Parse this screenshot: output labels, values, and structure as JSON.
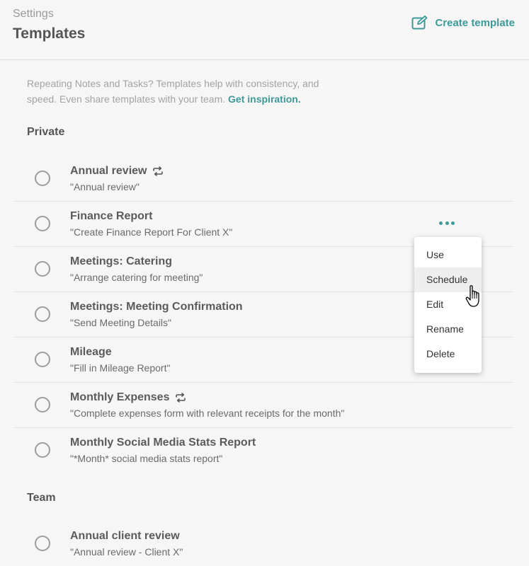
{
  "header": {
    "breadcrumb": "Settings",
    "title": "Templates",
    "create_label": "Create template"
  },
  "intro": {
    "text": "Repeating Notes and Tasks? Templates help with consistency, and speed. Even share templates with your team.",
    "link": "Get inspiration."
  },
  "sections": {
    "private": "Private",
    "team": "Team"
  },
  "private_templates": [
    {
      "name": "Annual review",
      "desc": "\"Annual review\"",
      "repeating": true
    },
    {
      "name": "Finance Report",
      "desc": "\"Create Finance Report For Client X\"",
      "repeating": false
    },
    {
      "name": "Meetings: Catering",
      "desc": "\"Arrange catering for meeting\"",
      "repeating": false
    },
    {
      "name": "Meetings: Meeting Confirmation",
      "desc": "\"Send Meeting Details\"",
      "repeating": false
    },
    {
      "name": "Mileage",
      "desc": "\"Fill in Mileage Report\"",
      "repeating": false
    },
    {
      "name": "Monthly Expenses",
      "desc": "\"Complete expenses form with relevant receipts for the month\"",
      "repeating": true
    },
    {
      "name": "Monthly Social Media Stats Report",
      "desc": "\"*Month* social media stats report\"",
      "repeating": false
    }
  ],
  "team_templates": [
    {
      "name": "Annual client review",
      "desc": "\"Annual review - Client X\"",
      "repeating": false
    }
  ],
  "context_menu": {
    "items": [
      "Use",
      "Schedule",
      "Edit",
      "Rename",
      "Delete"
    ],
    "highlighted": "Schedule"
  },
  "colors": {
    "accent": "#3d9a98",
    "background": "#f6f6f6"
  }
}
